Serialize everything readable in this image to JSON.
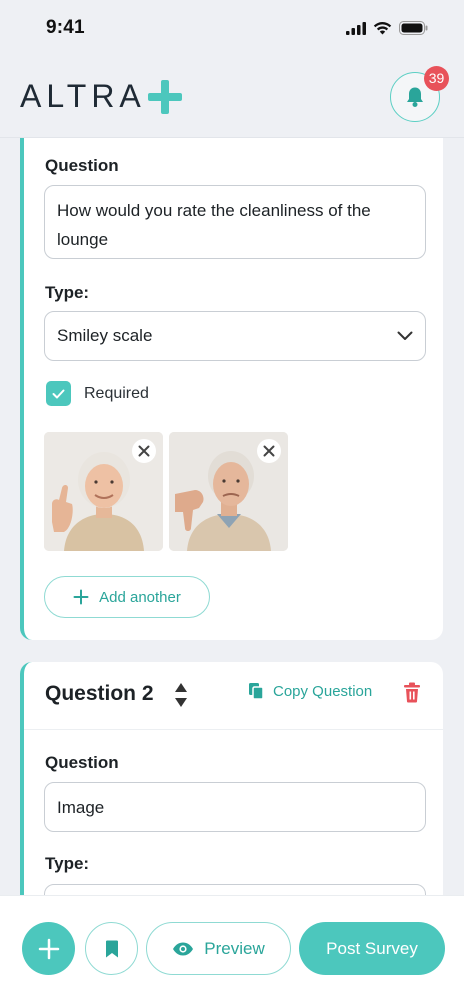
{
  "status_bar": {
    "time": "9:41"
  },
  "header": {
    "logo_text": "ALTRA",
    "notification_count": "39"
  },
  "question1": {
    "question_label": "Question",
    "question_text": "How would you rate the cleanliness of the lounge",
    "type_label": "Type:",
    "type_value": "Smiley scale",
    "required_label": "Required",
    "required_checked": true,
    "images": [
      {
        "name": "elderly woman thumbs up"
      },
      {
        "name": "elderly man thumbs down"
      }
    ],
    "add_another_label": "Add another"
  },
  "question2": {
    "title": "Question 2",
    "copy_label": "Copy Question",
    "question_label": "Question",
    "question_text": "Image",
    "type_label": "Type:"
  },
  "bottom_bar": {
    "preview_label": "Preview",
    "post_label": "Post Survey"
  },
  "colors": {
    "accent": "#4cc7bd",
    "accent_text": "#2aa59a",
    "danger": "#e8525a",
    "background": "#eef0f4"
  }
}
